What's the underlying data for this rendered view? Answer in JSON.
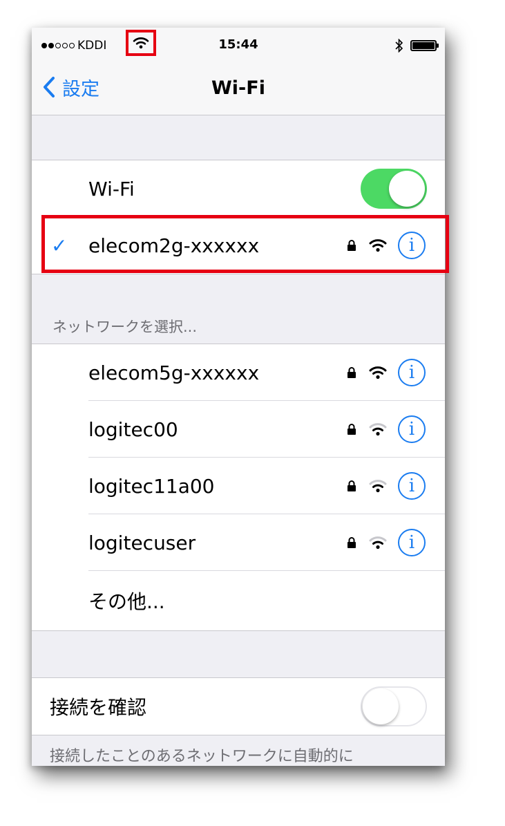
{
  "status_bar": {
    "carrier": "KDDI",
    "time": "15:44"
  },
  "nav": {
    "back_label": "設定",
    "title": "Wi-Fi"
  },
  "wifi_toggle": {
    "label": "Wi-Fi",
    "state": "on"
  },
  "connected_network": {
    "name": "elecom2g-xxxxxx",
    "secured": true
  },
  "section_header": "ネットワークを選択...",
  "networks": [
    {
      "name": "elecom5g-xxxxxx",
      "secured": true
    },
    {
      "name": "logitec00",
      "secured": true
    },
    {
      "name": "logitec11a00",
      "secured": true
    },
    {
      "name": "logitecuser",
      "secured": true
    }
  ],
  "other_label": "その他...",
  "ask_to_join": {
    "label": "接続を確認",
    "state": "off",
    "footer": "接続したことのあるネットワークに自動的に"
  },
  "colors": {
    "accent_blue": "#1a7cf0",
    "toggle_green": "#4cd964",
    "highlight_red": "#e60012",
    "background": "#efeff4"
  }
}
